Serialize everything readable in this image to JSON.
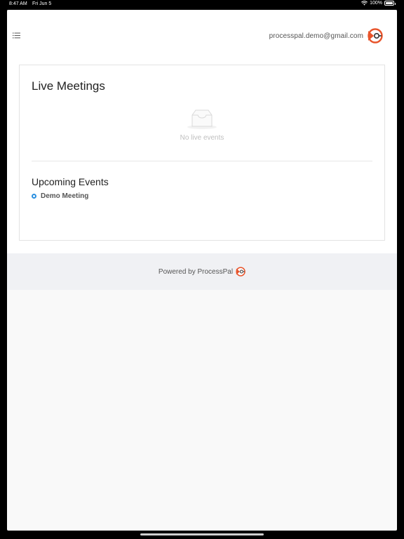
{
  "status_bar": {
    "time": "8:47 AM",
    "date": "Fri Jun 5",
    "battery": "100%"
  },
  "header": {
    "user_email": "processpal.demo@gmail.com"
  },
  "live_meetings": {
    "title": "Live Meetings",
    "empty_text": "No live events"
  },
  "upcoming_events": {
    "title": "Upcoming Events",
    "items": [
      {
        "label": "Demo Meeting"
      }
    ]
  },
  "footer": {
    "powered_by": "Powered by ProcessPal"
  },
  "colors": {
    "accent_blue": "#2a8fe0",
    "brand_orange": "#e8542b",
    "footer_bg": "#f0f1f4"
  },
  "icons": {
    "menu": "list-icon",
    "logo": "processpal-logo-icon",
    "empty": "inbox-icon"
  }
}
